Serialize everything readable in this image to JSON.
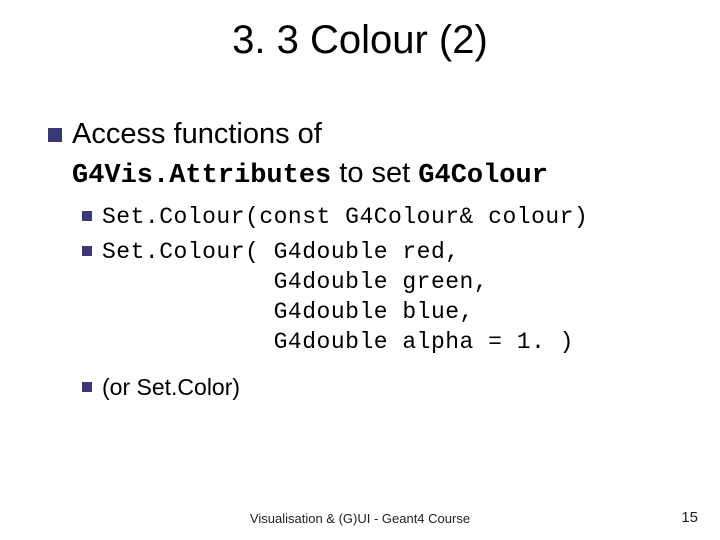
{
  "title": "3. 3 Colour (2)",
  "main_bullet": {
    "prefix": "Access functions of ",
    "code1": "G4Vis.Attributes",
    "mid": " to set ",
    "code2": "G4Colour"
  },
  "sub_bullets": [
    {
      "type": "code_single",
      "text": "Set.Colour(const G4Colour& colour)"
    },
    {
      "type": "code_multi",
      "lines": [
        "Set.Colour( G4double red,",
        "            G4double green,",
        "            G4double blue,",
        "            G4double alpha = 1. )"
      ]
    },
    {
      "type": "plain",
      "text": "(or Set.Color)"
    }
  ],
  "footer": "Visualisation & (G)UI - Geant4 Course",
  "page_number": "15"
}
